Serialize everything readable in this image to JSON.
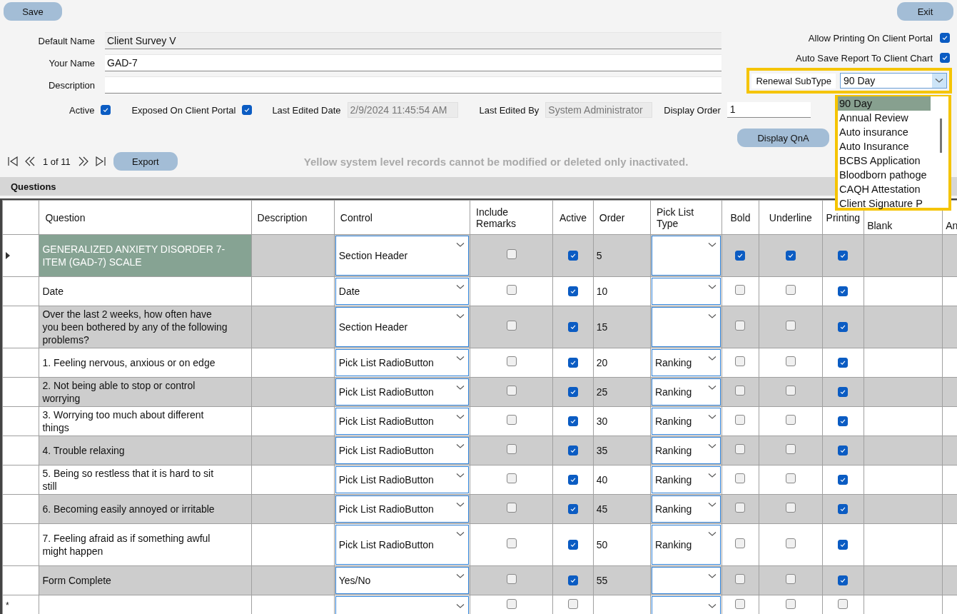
{
  "buttons": {
    "save": "Save",
    "exit": "Exit",
    "display_qna": "Display QnA",
    "export": "Export"
  },
  "fields": [
    {
      "label": "Default Name",
      "value": "Client Survey V",
      "readonly": true
    },
    {
      "label": "Your Name",
      "value": "GAD-7",
      "readonly": false
    },
    {
      "label": "Description",
      "readonly": false
    }
  ],
  "options_right": [
    {
      "label": "Allow Printing On Client Portal",
      "checked": true
    },
    {
      "label": "Auto Save Report To Client Chart",
      "checked": true
    }
  ],
  "renewal_subtype": {
    "label": "Renewal SubType",
    "value": "90 Day",
    "expanded": true,
    "options": [
      {
        "label": "90 Day",
        "selected": true
      },
      {
        "label": "Annual Review",
        "selected": false
      },
      {
        "label": "Auto insurance",
        "selected": false
      },
      {
        "label": "Auto Insurance",
        "selected": false
      },
      {
        "label": "BCBS Application",
        "selected": false
      },
      {
        "label": "Bloodborn pathoge",
        "selected": false
      },
      {
        "label": "CAQH Attestation",
        "selected": false
      },
      {
        "label": "Client Signature P",
        "selected": false
      }
    ]
  },
  "status_row": {
    "active": {
      "label": "Active",
      "checked": true
    },
    "exposed": {
      "label": "Exposed On Client Portal",
      "checked": true
    },
    "last_edited_date": {
      "label": "Last Edited Date",
      "value": "2/9/2024 11:45:54 AM"
    },
    "last_edited_by": {
      "label": "Last Edited By",
      "value": "System Administrator"
    },
    "display_order": {
      "label": "Display Order",
      "value": "1"
    }
  },
  "navigator": {
    "position": "1 of 11"
  },
  "message": "Yellow system level records cannot be modified or deleted only inactivated.",
  "questions": {
    "title": "Questions",
    "columns": [
      "Question",
      "Description",
      "Control",
      "Include Remarks",
      "Active",
      "Order",
      "Pick List Type",
      "Bold",
      "Underline",
      "Printing",
      "Blank",
      "An"
    ],
    "rows": [
      {
        "selected": true,
        "question": "GENERALIZED ANXIETY DISORDER 7-ITEM (GAD-7) SCALE",
        "control": "Section Header",
        "include_remarks": false,
        "active": true,
        "order": "5",
        "bold": true,
        "underline": true,
        "printing": true
      },
      {
        "selected": false,
        "question": "Date",
        "control": "Date",
        "include_remarks": false,
        "active": true,
        "order": "10",
        "bold": false,
        "underline": false,
        "printing": true
      },
      {
        "selected": false,
        "question": "Over the last 2 weeks, how often have you been bothered by any of the following problems?",
        "control": "Section Header",
        "include_remarks": false,
        "active": true,
        "order": "15",
        "bold": false,
        "underline": false,
        "printing": true
      },
      {
        "selected": false,
        "question": "1.  Feeling nervous, anxious or on edge",
        "control": "Pick List RadioButton",
        "include_remarks": false,
        "active": true,
        "order": "20",
        "pick_list_type": "Ranking",
        "bold": false,
        "underline": false,
        "printing": true
      },
      {
        "selected": false,
        "question": "2.  Not being able to stop or control worrying",
        "control": "Pick List RadioButton",
        "include_remarks": false,
        "active": true,
        "order": "25",
        "pick_list_type": "Ranking",
        "bold": false,
        "underline": false,
        "printing": true
      },
      {
        "selected": false,
        "question": "3.  Worrying too much about different things",
        "control": "Pick List RadioButton",
        "include_remarks": false,
        "active": true,
        "order": "30",
        "pick_list_type": "Ranking",
        "bold": false,
        "underline": false,
        "printing": true
      },
      {
        "selected": false,
        "question": "4.  Trouble relaxing",
        "control": "Pick List RadioButton",
        "include_remarks": false,
        "active": true,
        "order": "35",
        "pick_list_type": "Ranking",
        "bold": false,
        "underline": false,
        "printing": true
      },
      {
        "selected": false,
        "question": "5.  Being so restless that it is hard to sit still",
        "control": "Pick List RadioButton",
        "include_remarks": false,
        "active": true,
        "order": "40",
        "pick_list_type": "Ranking",
        "bold": false,
        "underline": false,
        "printing": true
      },
      {
        "selected": false,
        "question": "6.  Becoming easily annoyed or irritable",
        "control": "Pick List RadioButton",
        "include_remarks": false,
        "active": true,
        "order": "45",
        "pick_list_type": "Ranking",
        "bold": false,
        "underline": false,
        "printing": true
      },
      {
        "selected": false,
        "question": "7.  Feeling afraid as if something awful might happen",
        "control": "Pick List RadioButton",
        "include_remarks": false,
        "active": true,
        "order": "50",
        "pick_list_type": "Ranking",
        "bold": false,
        "underline": false,
        "printing": true
      },
      {
        "selected": false,
        "question": "Form Complete",
        "control": "Yes/No",
        "include_remarks": false,
        "active": true,
        "order": "55",
        "bold": false,
        "underline": false,
        "printing": true
      }
    ],
    "new_row": {
      "marker": "*",
      "include_remarks": false,
      "active": false,
      "bold": false,
      "underline": false,
      "printing": false
    }
  }
}
